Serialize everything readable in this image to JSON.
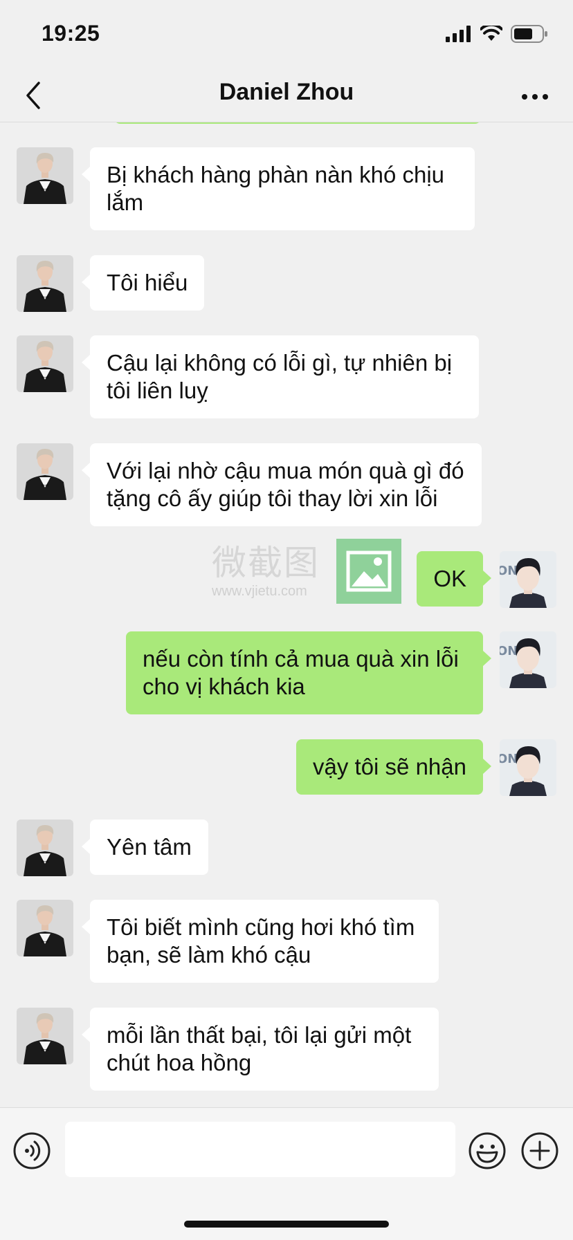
{
  "status_bar": {
    "time": "19:25"
  },
  "header": {
    "title": "Daniel Zhou"
  },
  "messages": [
    {
      "side": "left",
      "text": "Bị khách hàng phàn nàn khó chịu lắm"
    },
    {
      "side": "left",
      "text": "Tôi hiểu"
    },
    {
      "side": "left",
      "text": "Cậu lại không có lỗi gì, tự nhiên bị tôi liên luỵ"
    },
    {
      "side": "left",
      "text": "Với lại nhờ cậu mua món quà gì đó tặng cô ấy giúp tôi thay lời xin lỗi"
    },
    {
      "side": "right",
      "text": "OK"
    },
    {
      "side": "right",
      "text": "nếu còn tính cả mua quà xin lỗi cho vị khách kia"
    },
    {
      "side": "right",
      "text": "vậy tôi sẽ nhận"
    },
    {
      "side": "left",
      "text": "Yên tâm"
    },
    {
      "side": "left",
      "text": "Tôi biết mình cũng hơi khó tìm bạn, sẽ làm khó cậu"
    },
    {
      "side": "left",
      "text": "mỗi lần thất bại, tôi lại gửi một chút hoa hồng"
    }
  ],
  "watermark": {
    "cn": "微截图",
    "url": "www.vjietu.com"
  },
  "input": {
    "value": "",
    "placeholder": ""
  },
  "colors": {
    "background": "#f0f0f0",
    "sent_bubble": "#a9e97a",
    "received_bubble": "#ffffff"
  }
}
